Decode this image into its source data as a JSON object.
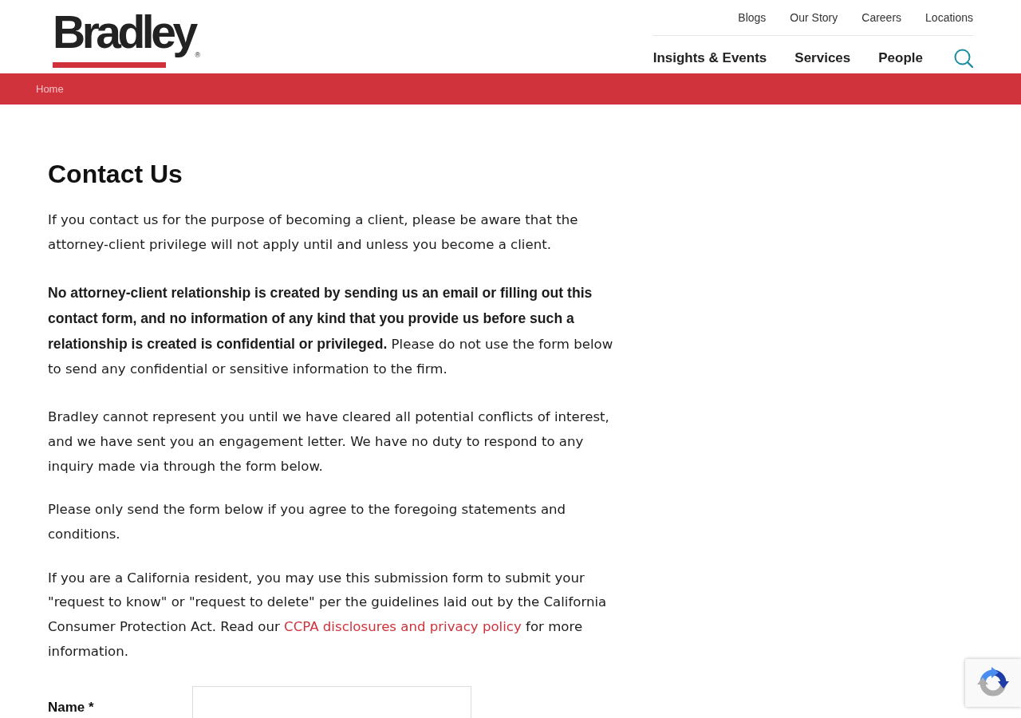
{
  "header": {
    "logo": {
      "text": "Bradley",
      "mark": "®"
    },
    "utility_nav": [
      "Blogs",
      "Our Story",
      "Careers",
      "Locations"
    ],
    "main_nav": [
      "Insights & Events",
      "Services",
      "People"
    ]
  },
  "breadcrumb": [
    "Home"
  ],
  "page": {
    "title": "Contact Us",
    "paragraphs": [
      {
        "kind": "text",
        "text": "If you contact us for the purpose of becoming a client, please be aware that the attorney-client privilege will not apply until and unless you become a client."
      },
      {
        "kind": "text",
        "text": "**No attorney-client relationship is created by sending us an email or filling out this contact form, and no information of any kind that you provide us before such a relationship is created is confidential or privileged.** Please do not use the form below to send any confidential or sensitive information to the firm."
      },
      {
        "kind": "text",
        "text": "Bradley cannot represent you until we have cleared all potential conflicts of interest, and we have sent you an engagement letter. We have no duty to respond to any inquiry made via through the form below."
      },
      {
        "kind": "text",
        "text": "Please only send the form below if you agree to the foregoing statements and conditions."
      },
      {
        "kind": "link",
        "before": "If you are a California resident, you may use this submission form to submit your \"request to know\" or \"request to delete\" per the guidelines laid out by the California Consumer Protection Act. Read our",
        "link": "CCPA disclosures and privacy policy",
        "after": "for more information."
      }
    ]
  },
  "form": {
    "fields": [
      {
        "label": "Name *"
      }
    ]
  }
}
